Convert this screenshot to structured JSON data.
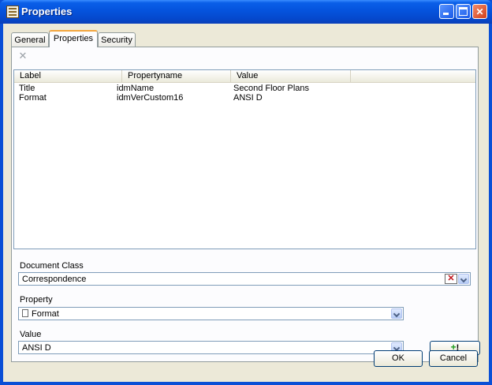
{
  "window": {
    "title": "Properties"
  },
  "tabs": [
    {
      "label": "General"
    },
    {
      "label": "Properties"
    },
    {
      "label": "Security"
    }
  ],
  "toolbar": {
    "delete_icon": "delete-x-icon"
  },
  "list": {
    "columns": [
      "Label",
      "Propertyname",
      "Value"
    ],
    "rows": [
      {
        "label": "Title",
        "propertyname": "idmName",
        "value": "Second Floor Plans"
      },
      {
        "label": "Format",
        "propertyname": "idmVerCustom16",
        "value": "ANSI D"
      }
    ]
  },
  "document_class": {
    "label": "Document Class",
    "value": "Correspondence"
  },
  "property": {
    "label": "Property",
    "value": "Format"
  },
  "value_field": {
    "label": "Value",
    "value": "ANSI D"
  },
  "add_button": {
    "plus": "+",
    "mark": "!"
  },
  "buttons": {
    "ok": "OK",
    "cancel": "Cancel"
  }
}
